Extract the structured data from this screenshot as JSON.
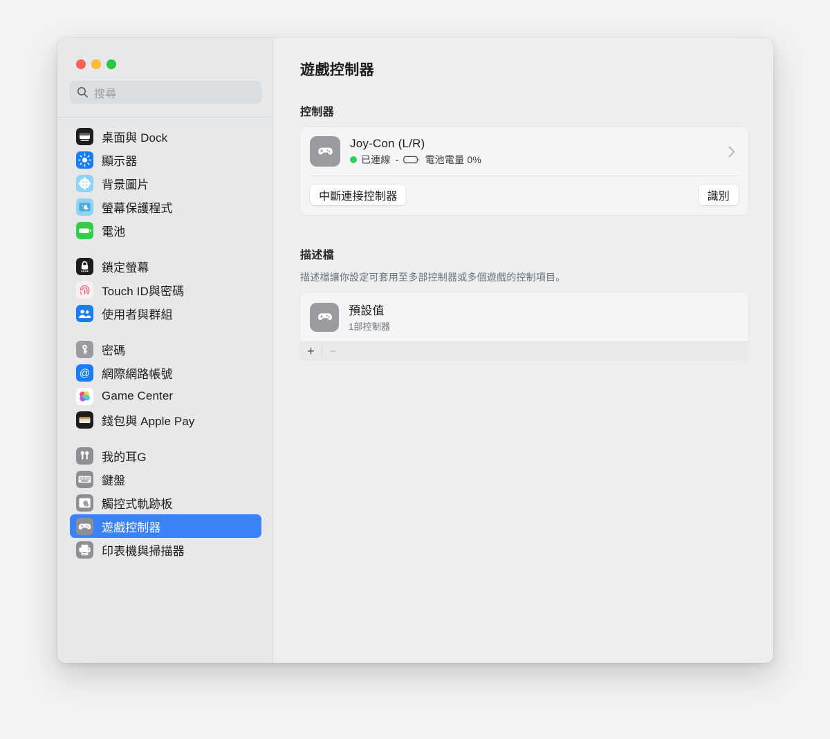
{
  "window": {
    "traffic_lights": [
      "close",
      "minimize",
      "zoom"
    ]
  },
  "sidebar": {
    "search": {
      "placeholder": "搜尋",
      "value": "",
      "icon": "search-icon"
    },
    "groups": [
      {
        "items": [
          {
            "label": "桌面與 Dock",
            "icon": "desktop-dock-icon",
            "selected": false
          },
          {
            "label": "顯示器",
            "icon": "displays-icon",
            "selected": false
          },
          {
            "label": "背景圖片",
            "icon": "wallpaper-icon",
            "selected": false
          },
          {
            "label": "螢幕保護程式",
            "icon": "screensaver-icon",
            "selected": false
          },
          {
            "label": "電池",
            "icon": "battery-icon",
            "selected": false
          }
        ]
      },
      {
        "items": [
          {
            "label": "鎖定螢幕",
            "icon": "lock-screen-icon",
            "selected": false
          },
          {
            "label": "Touch ID與密碼",
            "icon": "touch-id-icon",
            "selected": false
          },
          {
            "label": "使用者與群組",
            "icon": "users-groups-icon",
            "selected": false
          }
        ]
      },
      {
        "items": [
          {
            "label": "密碼",
            "icon": "passwords-key-icon",
            "selected": false
          },
          {
            "label": "網際網路帳號",
            "icon": "internet-accounts-icon",
            "selected": false
          },
          {
            "label": "Game Center",
            "icon": "game-center-icon",
            "selected": false
          },
          {
            "label": "錢包與 Apple Pay",
            "icon": "wallet-apple-pay-icon",
            "selected": false
          }
        ]
      },
      {
        "items": [
          {
            "label": "我的耳G",
            "icon": "airpods-icon",
            "selected": false
          },
          {
            "label": "鍵盤",
            "icon": "keyboard-icon",
            "selected": false
          },
          {
            "label": "觸控式軌跡板",
            "icon": "trackpad-icon",
            "selected": false
          },
          {
            "label": "遊戲控制器",
            "icon": "game-controller-icon",
            "selected": true
          },
          {
            "label": "印表機與掃描器",
            "icon": "printers-scanners-icon",
            "selected": false
          }
        ]
      }
    ]
  },
  "detail": {
    "title": "遊戲控制器",
    "controllers_section": {
      "heading": "控制器",
      "controller": {
        "icon": "game-controller-icon",
        "name": "Joy-Con (L/R)",
        "status_dot_color": "#30d158",
        "status_text": "已連線",
        "separator": "-",
        "battery_icon": "battery-empty-icon",
        "battery_text": "電池電量 0%",
        "disclosure_icon": "chevron-right-icon"
      },
      "disconnect_button": "中斷連接控制器",
      "identify_button": "識別"
    },
    "profiles_section": {
      "heading": "描述檔",
      "description": "描述檔讓你設定可套用至多部控制器或多個遊戲的控制項目。",
      "profiles": [
        {
          "icon": "game-controller-icon",
          "name": "預設值",
          "meta": "1部控制器"
        }
      ],
      "footer": {
        "add_label": "+",
        "remove_label": "−"
      }
    }
  },
  "colors": {
    "accent_blue": "#3a82f6",
    "connected_green": "#30d158",
    "window_bg": "#eceef0",
    "sidebar_bg": "#e6e8ea",
    "card_bg": "#f4f5f7"
  }
}
